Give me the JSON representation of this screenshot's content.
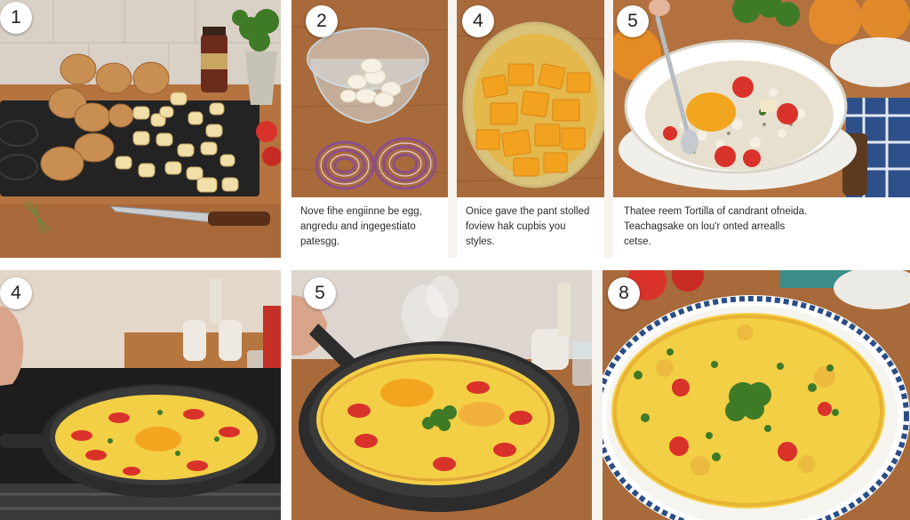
{
  "steps": [
    {
      "number": "1"
    },
    {
      "number": "2",
      "caption": [
        "Nove fihe engiinne be egg,",
        "angredu and ingegestiato",
        "patesgg."
      ]
    },
    {
      "number": "4",
      "caption": [
        "Onice gave the pant stolled",
        "foview hak cupbis you",
        "styles."
      ]
    },
    {
      "number": "5",
      "caption": [
        "Thatee reem Tortilla of candrant ofneida.",
        "Teachagsake on lou'r onted arrealls",
        "cetse."
      ]
    },
    {
      "number": "4"
    },
    {
      "number": "5"
    },
    {
      "number": "8"
    }
  ],
  "colors": {
    "wood": "#b5733f",
    "egg": "#f3cf45",
    "yolk": "#f2a51e",
    "tomato": "#d9322a",
    "herb": "#3f7a26",
    "pan": "#2c2c2c",
    "plate_rim": "#2a4d86"
  }
}
